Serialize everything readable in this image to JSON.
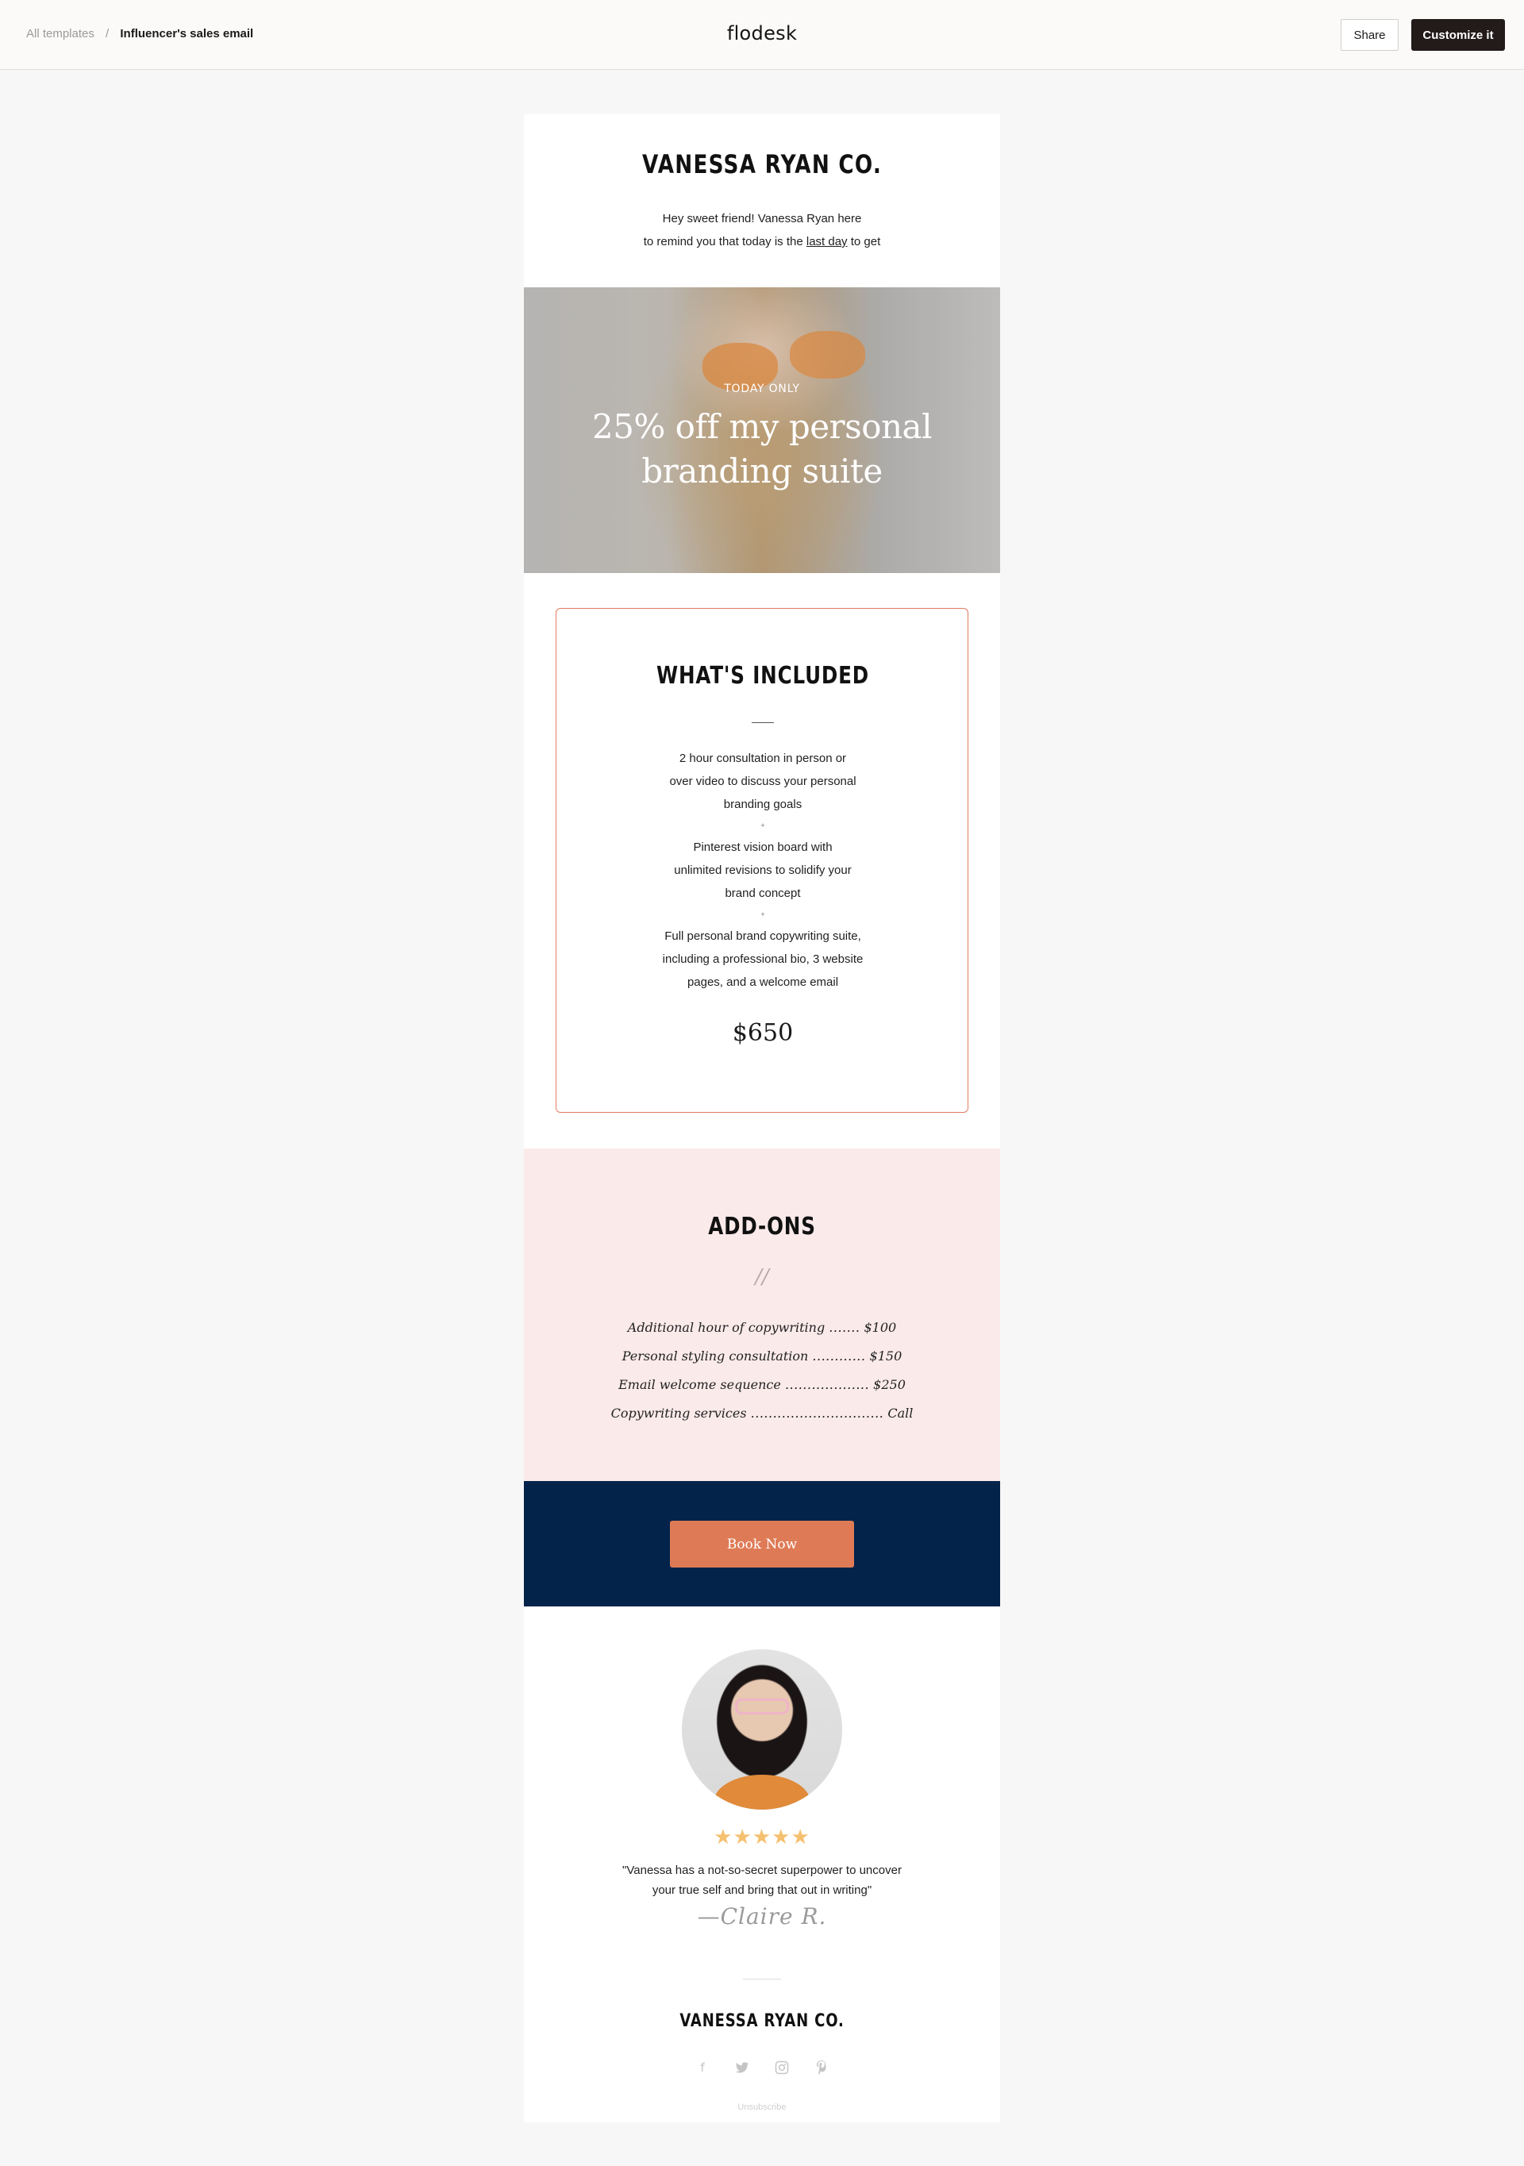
{
  "topbar": {
    "breadcrumb": {
      "parent": "All templates",
      "separator": "/",
      "current": "Influencer's sales email"
    },
    "brand": "flodesk",
    "share_label": "Share",
    "customize_label": "Customize it"
  },
  "email": {
    "header": {
      "title": "VANESSA RYAN CO.",
      "line1": "Hey sweet friend! Vanessa Ryan here",
      "line2_before": "to remind you that today is the ",
      "line2_link": "last day",
      "line2_after": " to get"
    },
    "hero": {
      "eyebrow": "TODAY ONLY",
      "title_line1": "25% off my personal",
      "title_line2": "branding suite"
    },
    "included": {
      "title": "WHAT'S INCLUDED",
      "items": [
        [
          "2 hour consultation in person or",
          "over video to discuss your personal",
          "branding goals"
        ],
        [
          "Pinterest vision board with",
          "unlimited revisions to solidify your",
          "brand concept"
        ],
        [
          "Full personal brand copywriting suite,",
          "including a professional bio, 3 website",
          "pages, and a welcome email"
        ]
      ],
      "separator": "+",
      "price": "$650"
    },
    "addons": {
      "title": "ADD-ONS",
      "divider": "//",
      "items": [
        {
          "name": "Additional hour of copywriting",
          "dots": ".......",
          "price": "$100"
        },
        {
          "name": "Personal styling consultation",
          "dots": "............",
          "price": "$150"
        },
        {
          "name": "Email welcome sequence",
          "dots": "...................",
          "price": "$250"
        },
        {
          "name": "Copywriting services",
          "dots": "..............................",
          "price": "Call"
        }
      ]
    },
    "cta": {
      "label": "Book Now"
    },
    "testimonial": {
      "stars": "★★★★★",
      "rating": 5,
      "quote_line1": "\"Vanessa has a not-so-secret superpower to uncover",
      "quote_line2": "your true self and bring that out in writing\"",
      "signature": "—Claire R."
    },
    "footer": {
      "title": "VANESSA RYAN CO.",
      "socials": [
        {
          "icon": "facebook-icon",
          "glyph": "f"
        },
        {
          "icon": "twitter-icon",
          "glyph": "t"
        },
        {
          "icon": "instagram-icon",
          "glyph": "◎"
        },
        {
          "icon": "pinterest-icon",
          "glyph": "p"
        }
      ],
      "unsubscribe": "Unsubscribe"
    }
  },
  "colors": {
    "accent_orange": "#de7b56",
    "box_border": "#e07a5f",
    "addons_bg": "#fbeaea",
    "cta_bg": "#03234a",
    "star": "#f5c06f",
    "dark_button": "#231a1a"
  }
}
